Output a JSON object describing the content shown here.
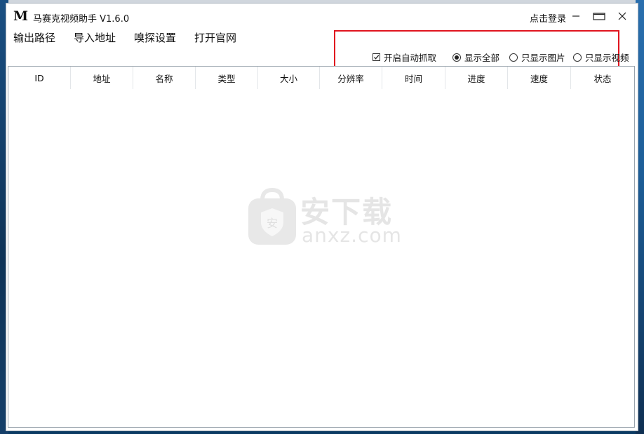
{
  "app": {
    "logo_text": "M",
    "title": "马赛克视频助手 V1.6.0",
    "login_label": "点击登录"
  },
  "menu": [
    {
      "label": "输出路径"
    },
    {
      "label": "导入地址"
    },
    {
      "label": "嗅探设置"
    },
    {
      "label": "打开官网"
    }
  ],
  "options": {
    "auto_capture": {
      "label": "开启自动抓取",
      "checked": true
    },
    "radios": [
      {
        "label": "显示全部",
        "selected": true
      },
      {
        "label": "只显示图片",
        "selected": false
      },
      {
        "label": "只显示视频",
        "selected": false
      }
    ]
  },
  "table": {
    "columns": [
      "ID",
      "地址",
      "名称",
      "类型",
      "大小",
      "分辨率",
      "时间",
      "进度",
      "速度",
      "状态"
    ],
    "rows": []
  },
  "watermark": {
    "line1": "安下载",
    "line2": "anxz.com"
  },
  "colors": {
    "highlight_box": "#e0141e",
    "window_bg": "#ffffff"
  }
}
